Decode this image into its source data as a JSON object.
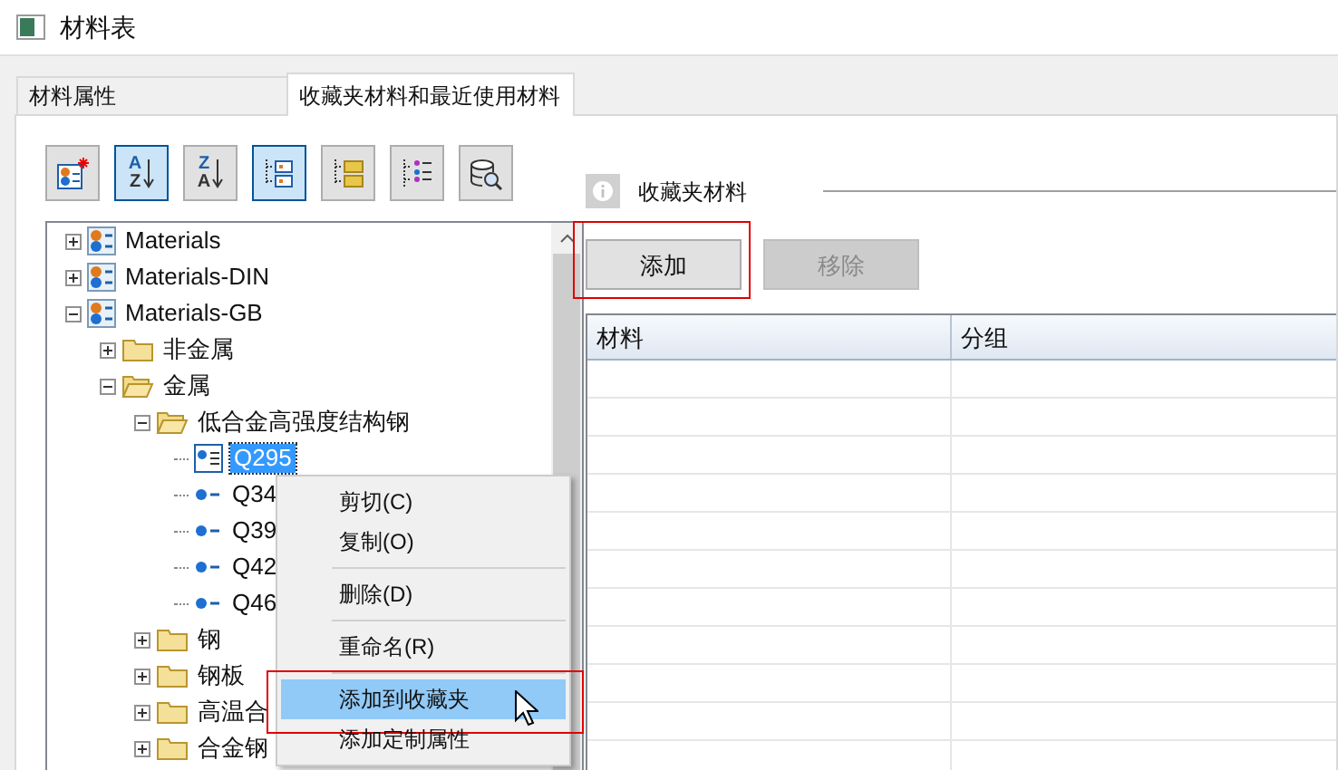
{
  "window": {
    "title": "材料表"
  },
  "tabs": [
    {
      "label": "材料属性",
      "selected": false
    },
    {
      "label": "收藏夹材料和最近使用材料",
      "selected": true
    }
  ],
  "toolbar": [
    {
      "kind": "new-material",
      "selected": false
    },
    {
      "kind": "sort",
      "letters": [
        "A",
        "Z"
      ],
      "selected": true
    },
    {
      "kind": "sort",
      "letters": [
        "Z",
        "A"
      ],
      "selected": false
    },
    {
      "kind": "tree-view",
      "selected": true
    },
    {
      "kind": "folder-view",
      "selected": false
    },
    {
      "kind": "list-view",
      "selected": false
    },
    {
      "kind": "database-search",
      "selected": false
    }
  ],
  "tree": [
    {
      "label": "Materials",
      "kind": "library",
      "expanded": false
    },
    {
      "label": "Materials-DIN",
      "kind": "library",
      "expanded": false
    },
    {
      "label": "Materials-GB",
      "kind": "library",
      "expanded": true,
      "children": [
        {
          "label": "非金属",
          "kind": "folder",
          "expanded": false
        },
        {
          "label": "金属",
          "kind": "folder",
          "expanded": true,
          "children": [
            {
              "label": "低合金高强度结构钢",
              "kind": "folder",
              "expanded": true,
              "children": [
                {
                  "label": "Q295",
                  "kind": "material",
                  "selected": true
                },
                {
                  "label": "Q34",
                  "kind": "material",
                  "selected": false
                },
                {
                  "label": "Q39",
                  "kind": "material",
                  "selected": false
                },
                {
                  "label": "Q42",
                  "kind": "material",
                  "selected": false
                },
                {
                  "label": "Q46",
                  "kind": "material",
                  "selected": false
                }
              ]
            },
            {
              "label": "钢",
              "kind": "folder",
              "expanded": false
            },
            {
              "label": "钢板",
              "kind": "folder",
              "expanded": false
            },
            {
              "label": "高温合",
              "kind": "folder",
              "expanded": false
            },
            {
              "label": "合金钢",
              "kind": "folder",
              "expanded": false
            }
          ]
        }
      ]
    }
  ],
  "favorites": {
    "heading": "收藏夹材料",
    "buttons": [
      {
        "label": "添加",
        "disabled": false,
        "annotated": true
      },
      {
        "label": "移除",
        "disabled": true,
        "annotated": false
      }
    ],
    "table": {
      "columns": [
        "材料",
        "分组"
      ]
    }
  },
  "context_menu": {
    "items": [
      {
        "kind": "item",
        "label": "剪切(C)",
        "highlighted": false,
        "annotated": false
      },
      {
        "kind": "item",
        "label": "复制(O)",
        "highlighted": false,
        "annotated": false
      },
      {
        "kind": "separator"
      },
      {
        "kind": "item",
        "label": "删除(D)",
        "highlighted": false,
        "annotated": false
      },
      {
        "kind": "separator"
      },
      {
        "kind": "item",
        "label": "重命名(R)",
        "highlighted": false,
        "annotated": false
      },
      {
        "kind": "separator"
      },
      {
        "kind": "item",
        "label": "添加到收藏夹",
        "highlighted": true,
        "annotated": true
      },
      {
        "kind": "item",
        "label": "添加定制属性",
        "highlighted": false,
        "annotated": false
      }
    ]
  }
}
